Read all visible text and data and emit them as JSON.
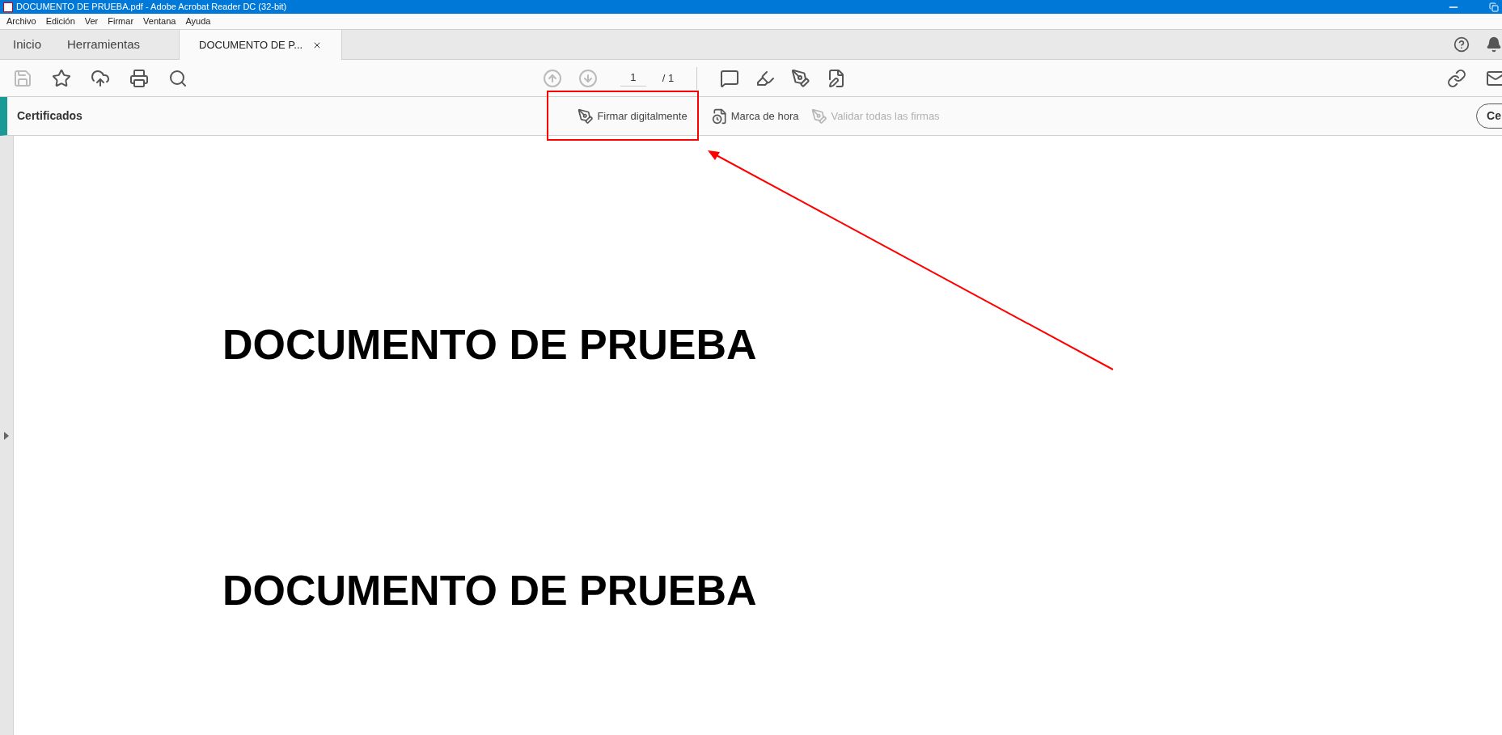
{
  "window": {
    "title": "DOCUMENTO DE PRUEBA.pdf - Adobe Acrobat Reader DC (32-bit)"
  },
  "menu": [
    "Archivo",
    "Edición",
    "Ver",
    "Firmar",
    "Ventana",
    "Ayuda"
  ],
  "tabs": [
    {
      "label": "Inicio",
      "selected": false,
      "closable": false
    },
    {
      "label": "Herramientas",
      "selected": false,
      "closable": false
    },
    {
      "label": "DOCUMENTO DE P...",
      "selected": true,
      "closable": true
    }
  ],
  "toolbar": {
    "page_current": "1",
    "page_total": "/ 1"
  },
  "tool_panel": {
    "title": "Certificados",
    "tools": [
      {
        "kind": "sign",
        "label": "Firmar digitalmente",
        "disabled": false,
        "highlighted": true
      },
      {
        "kind": "timestamp",
        "label": "Marca de hora",
        "disabled": false,
        "highlighted": false
      },
      {
        "kind": "validate",
        "label": "Validar todas las firmas",
        "disabled": true,
        "highlighted": false
      }
    ],
    "close_button": "Ce"
  },
  "document": {
    "headings": [
      "DOCUMENTO DE PRUEBA",
      "DOCUMENTO DE PRUEBA"
    ]
  }
}
